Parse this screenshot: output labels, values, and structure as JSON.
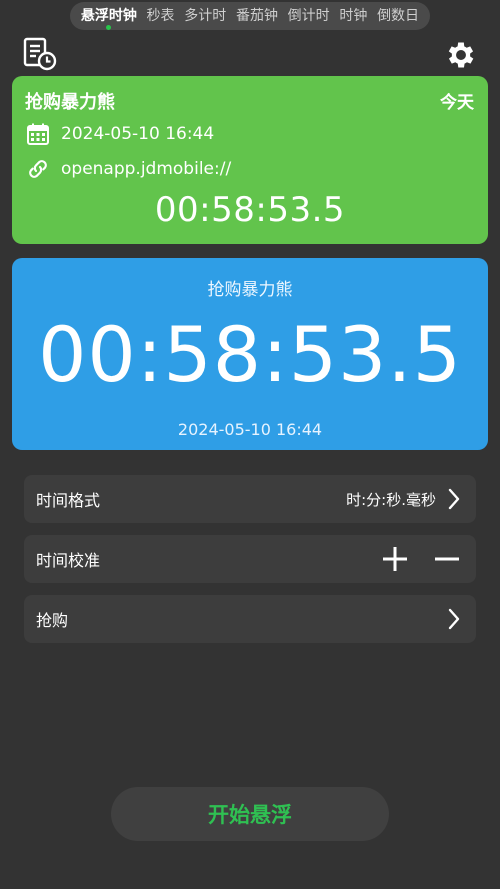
{
  "tabs": [
    {
      "label": "悬浮时钟",
      "active": true
    },
    {
      "label": "秒表",
      "active": false
    },
    {
      "label": "多计时",
      "active": false
    },
    {
      "label": "番茄钟",
      "active": false
    },
    {
      "label": "倒计时",
      "active": false
    },
    {
      "label": "时钟",
      "active": false
    },
    {
      "label": "倒数日",
      "active": false
    }
  ],
  "green_card": {
    "title": "抢购暴力熊",
    "badge": "今天",
    "datetime": "2024-05-10 16:44",
    "link": "openapp.jdmobile://",
    "countdown": "00:58:53.5",
    "color": "#62c44c"
  },
  "blue_card": {
    "title": "抢购暴力熊",
    "countdown": "00:58:53.5",
    "datetime": "2024-05-10 16:44",
    "color": "#2f9ee6"
  },
  "settings": {
    "time_format": {
      "label": "时间格式",
      "value": "时:分:秒.毫秒"
    },
    "calibration": {
      "label": "时间校准"
    },
    "purchase": {
      "label": "抢购"
    }
  },
  "start_button": {
    "label": "开始悬浮",
    "color": "#2fc052"
  },
  "icons": {
    "history": "history-list-icon",
    "settings": "gear-icon",
    "calendar": "calendar-icon",
    "link": "link-icon"
  }
}
